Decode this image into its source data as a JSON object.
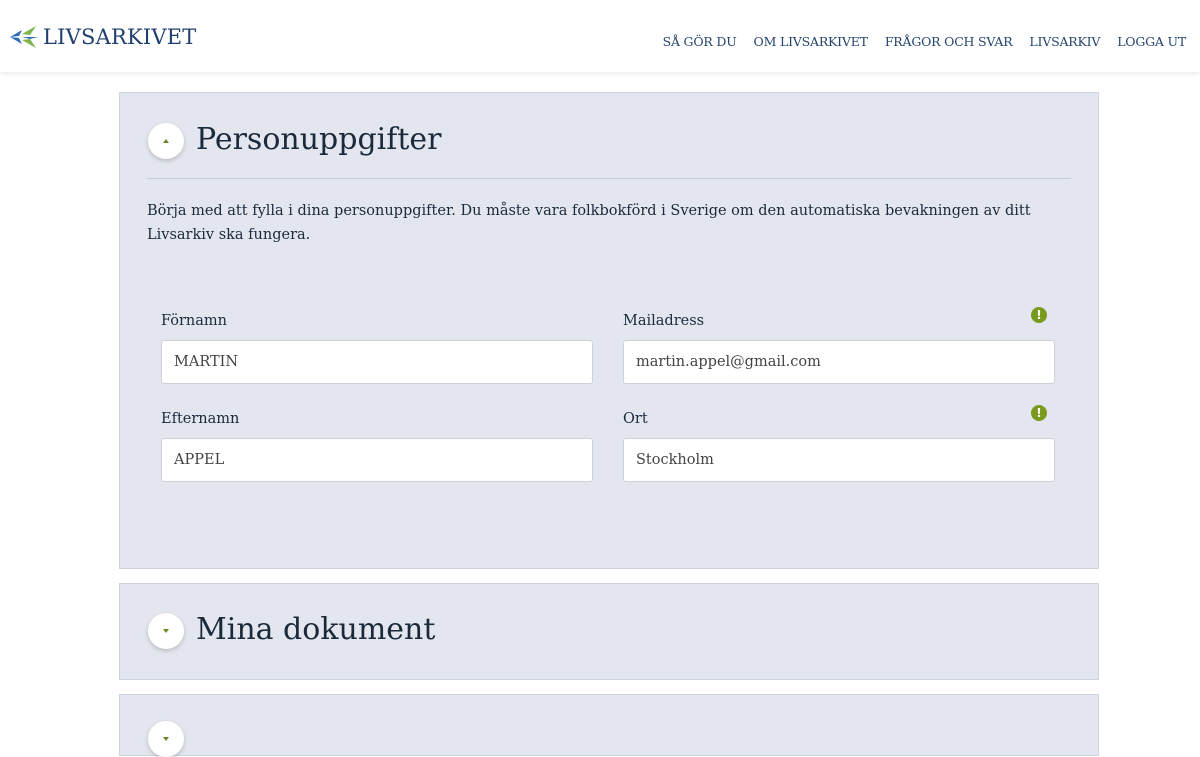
{
  "header": {
    "logo_text": "LIVSARKIVET",
    "nav": [
      "SÅ GÖR DU",
      "OM LIVSARKIVET",
      "FRÅGOR OCH SVAR",
      "LIVSARKIV",
      "LOGGA UT"
    ]
  },
  "sections": {
    "personal": {
      "title": "Personuppgifter",
      "expanded": true,
      "intro": "Börja med att fylla i dina personuppgifter. Du måste vara folkbokförd i Sverige om den automatiska bevakningen av ditt Livsarkiv ska fungera.",
      "fields": {
        "first_name": {
          "label": "Förnamn",
          "value": "MARTIN"
        },
        "email": {
          "label": "Mailadress",
          "value": "martin.appel@gmail.com",
          "warning": "!"
        },
        "last_name": {
          "label": "Efternamn",
          "value": "APPEL"
        },
        "city": {
          "label": "Ort",
          "value": "Stockholm",
          "warning": "!"
        }
      }
    },
    "documents": {
      "title": "Mina dokument",
      "expanded": false
    }
  },
  "colors": {
    "accent_green": "#7a9a1e",
    "navy": "#1f3f6e",
    "panel_bg": "#e3e6ee"
  },
  "icons": {
    "logo": "bird-arrows-icon",
    "warning": "exclamation-icon",
    "expand": "caret-up-icon",
    "collapse": "caret-down-icon"
  }
}
